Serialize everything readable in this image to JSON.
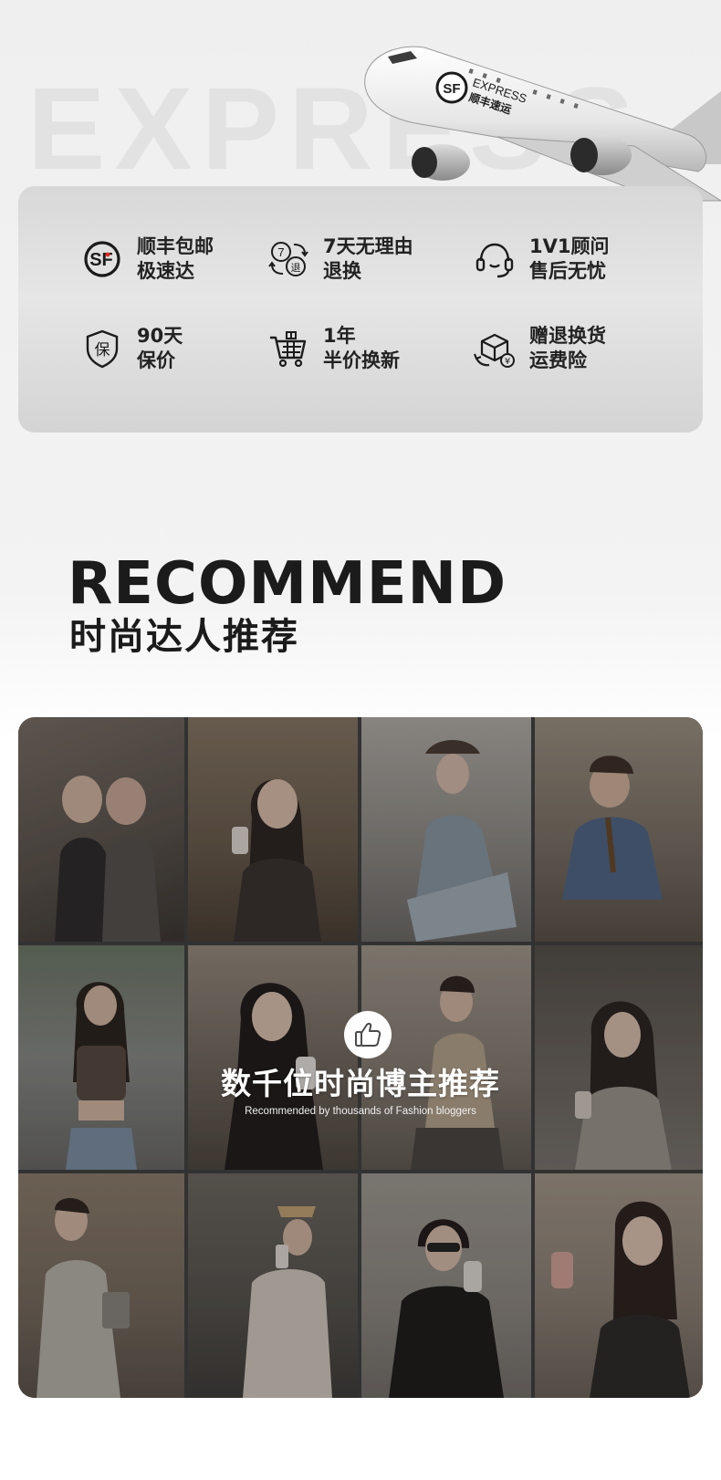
{
  "header": {
    "background_word": "EXPRESS",
    "plane_logo": {
      "mark": "SF",
      "brand": "EXPRESS",
      "cn": "顺丰速运"
    }
  },
  "services": [
    {
      "icon": "sf-logo-icon",
      "line1": "顺丰包邮",
      "line2": "极速达"
    },
    {
      "icon": "seven-day-return-icon",
      "badge_a": "7",
      "badge_b": "退",
      "line1": "7天无理由",
      "line2": "退换"
    },
    {
      "icon": "headset-icon",
      "line1": "1V1顾问",
      "line2": "售后无忧"
    },
    {
      "icon": "shield-icon",
      "badge": "保",
      "line1": "90天",
      "line2": "保价"
    },
    {
      "icon": "shopping-cart-icon",
      "line1": "1年",
      "line2": "半价换新"
    },
    {
      "icon": "return-box-icon",
      "badge": "¥",
      "line1": "赠退换货",
      "line2": "运费险"
    }
  ],
  "recommend": {
    "title": "RECOMMEND",
    "subtitle": "时尚达人推荐",
    "caption": "数千位时尚博主推荐",
    "caption_en": "Recommended by thousands of Fashion bloggers",
    "like_icon": "thumbs-up-icon"
  },
  "colors": {
    "accent_red": "#e0281e",
    "text_dark": "#1b1b1b"
  }
}
